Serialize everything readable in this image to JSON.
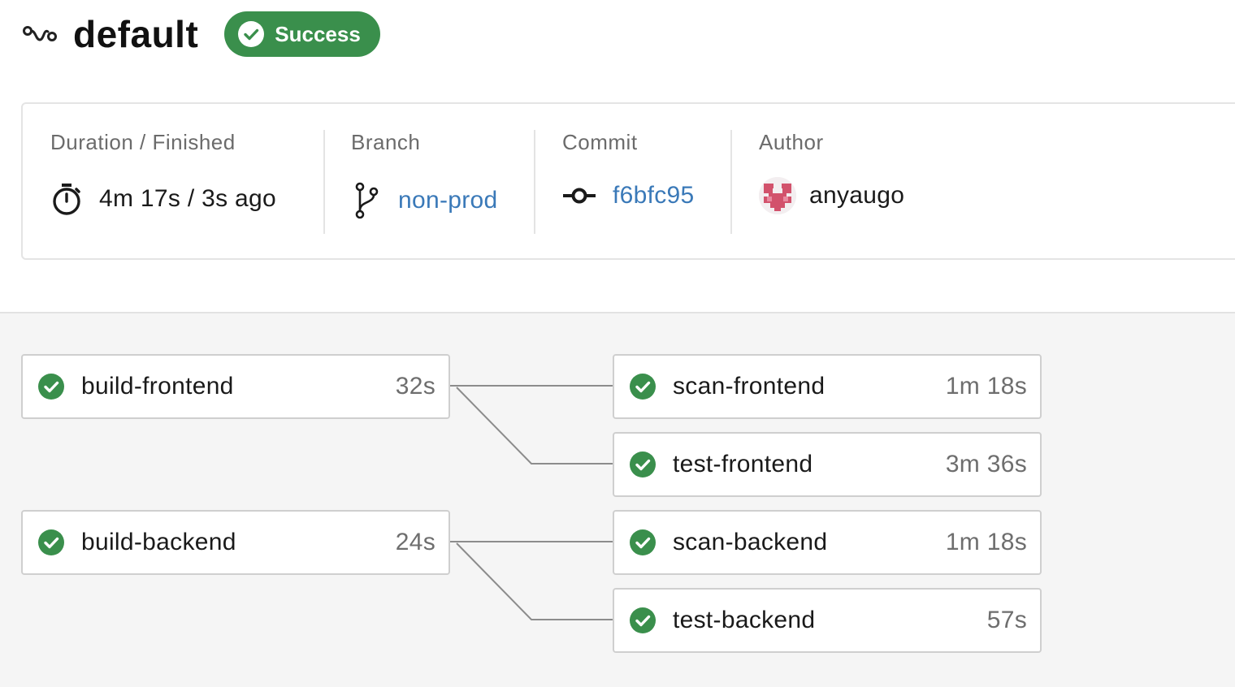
{
  "pipeline": {
    "title": "default",
    "status_label": "Success",
    "status_color": "#3a8f4c"
  },
  "details": {
    "duration": {
      "label": "Duration / Finished",
      "value": "4m 17s / 3s ago"
    },
    "branch": {
      "label": "Branch",
      "value": "non-prod"
    },
    "commit": {
      "label": "Commit",
      "value": "f6bfc95"
    },
    "author": {
      "label": "Author",
      "value": "anyaugo"
    }
  },
  "jobs": {
    "build_frontend": {
      "name": "build-frontend",
      "duration": "32s",
      "status": "success"
    },
    "scan_frontend": {
      "name": "scan-frontend",
      "duration": "1m 18s",
      "status": "success"
    },
    "test_frontend": {
      "name": "test-frontend",
      "duration": "3m 36s",
      "status": "success"
    },
    "build_backend": {
      "name": "build-backend",
      "duration": "24s",
      "status": "success"
    },
    "scan_backend": {
      "name": "scan-backend",
      "duration": "1m 18s",
      "status": "success"
    },
    "test_backend": {
      "name": "test-backend",
      "duration": "57s",
      "status": "success"
    }
  },
  "colors": {
    "success": "#3a8f4c",
    "link": "#3a79b8"
  }
}
